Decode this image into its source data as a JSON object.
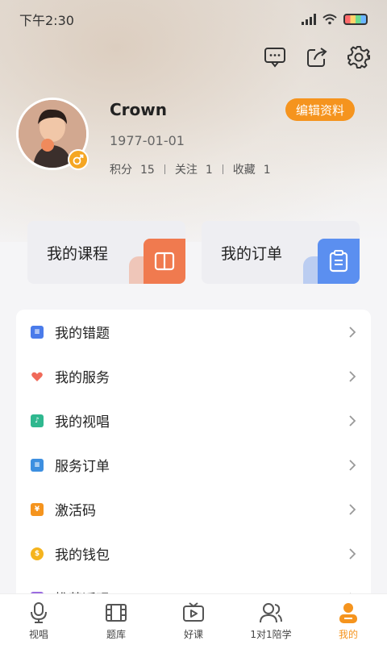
{
  "status_bar": {
    "time": "下午2:30"
  },
  "profile": {
    "name": "Crown",
    "edit_label": "编辑资料",
    "birthday": "1977-01-01",
    "stats": [
      {
        "label": "积分",
        "value": "15"
      },
      {
        "label": "关注",
        "value": "1"
      },
      {
        "label": "收藏",
        "value": "1"
      }
    ]
  },
  "quick_cards": [
    {
      "label": "我的课程",
      "icon": "book-icon",
      "color": "#f07a4f"
    },
    {
      "label": "我的订单",
      "icon": "clipboard-icon",
      "color": "#5b8ff0"
    }
  ],
  "menu": [
    {
      "label": "我的错题",
      "icon": "notebook-icon",
      "color": "#4a7bea"
    },
    {
      "label": "我的服务",
      "icon": "heart-hand-icon",
      "color": "#f06a5a"
    },
    {
      "label": "我的视唱",
      "icon": "sing-icon",
      "color": "#2fb88f"
    },
    {
      "label": "服务订单",
      "icon": "document-icon",
      "color": "#3d8fe0"
    },
    {
      "label": "激活码",
      "icon": "coupon-icon",
      "color": "#f5941e"
    },
    {
      "label": "我的钱包",
      "icon": "money-bag-icon",
      "color": "#f5b41e"
    },
    {
      "label": "推荐返现",
      "icon": "gift-icon",
      "color": "#9a6be0"
    }
  ],
  "tabs": [
    {
      "label": "视唱",
      "icon": "microphone-icon",
      "active": false
    },
    {
      "label": "题库",
      "icon": "film-icon",
      "active": false
    },
    {
      "label": "好课",
      "icon": "tv-play-icon",
      "active": false
    },
    {
      "label": "1对1陪学",
      "icon": "people-icon",
      "active": false
    },
    {
      "label": "我的",
      "icon": "person-icon",
      "active": true
    }
  ],
  "colors": {
    "accent": "#f5941e"
  }
}
